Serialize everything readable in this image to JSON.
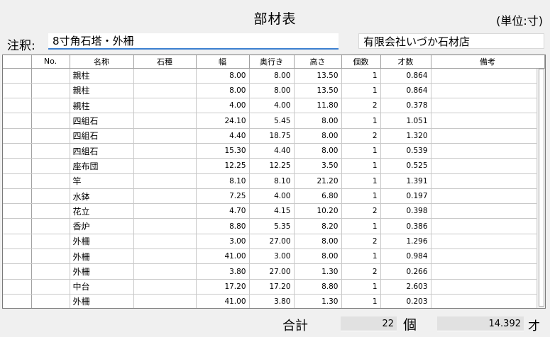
{
  "window": {
    "title": "部材表",
    "unit": "(単位:寸)"
  },
  "note": {
    "label": "注釈:",
    "value": "8寸角石塔・外柵"
  },
  "company": {
    "value": "有限会社いづか石材店"
  },
  "grid": {
    "columns": [
      "No.",
      "名称",
      "石種",
      "幅",
      "奥行き",
      "高さ",
      "個数",
      "才数",
      "備考"
    ],
    "rows": [
      {
        "no": "",
        "name": "親柱",
        "stone": "",
        "width": "8.00",
        "depth": "8.00",
        "height": "13.50",
        "count": "1",
        "size": "0.864",
        "remarks": ""
      },
      {
        "no": "",
        "name": "親柱",
        "stone": "",
        "width": "8.00",
        "depth": "8.00",
        "height": "13.50",
        "count": "1",
        "size": "0.864",
        "remarks": ""
      },
      {
        "no": "",
        "name": "親柱",
        "stone": "",
        "width": "4.00",
        "depth": "4.00",
        "height": "11.80",
        "count": "2",
        "size": "0.378",
        "remarks": ""
      },
      {
        "no": "",
        "name": "四組石",
        "stone": "",
        "width": "24.10",
        "depth": "5.45",
        "height": "8.00",
        "count": "1",
        "size": "1.051",
        "remarks": ""
      },
      {
        "no": "",
        "name": "四組石",
        "stone": "",
        "width": "4.40",
        "depth": "18.75",
        "height": "8.00",
        "count": "2",
        "size": "1.320",
        "remarks": ""
      },
      {
        "no": "",
        "name": "四組石",
        "stone": "",
        "width": "15.30",
        "depth": "4.40",
        "height": "8.00",
        "count": "1",
        "size": "0.539",
        "remarks": ""
      },
      {
        "no": "",
        "name": "座布団",
        "stone": "",
        "width": "12.25",
        "depth": "12.25",
        "height": "3.50",
        "count": "1",
        "size": "0.525",
        "remarks": ""
      },
      {
        "no": "",
        "name": "竿",
        "stone": "",
        "width": "8.10",
        "depth": "8.10",
        "height": "21.20",
        "count": "1",
        "size": "1.391",
        "remarks": ""
      },
      {
        "no": "",
        "name": "水鉢",
        "stone": "",
        "width": "7.25",
        "depth": "4.00",
        "height": "6.80",
        "count": "1",
        "size": "0.197",
        "remarks": ""
      },
      {
        "no": "",
        "name": "花立",
        "stone": "",
        "width": "4.70",
        "depth": "4.15",
        "height": "10.20",
        "count": "2",
        "size": "0.398",
        "remarks": ""
      },
      {
        "no": "",
        "name": "香炉",
        "stone": "",
        "width": "8.80",
        "depth": "5.35",
        "height": "8.20",
        "count": "1",
        "size": "0.386",
        "remarks": ""
      },
      {
        "no": "",
        "name": "外柵",
        "stone": "",
        "width": "3.00",
        "depth": "27.00",
        "height": "8.00",
        "count": "2",
        "size": "1.296",
        "remarks": ""
      },
      {
        "no": "",
        "name": "外柵",
        "stone": "",
        "width": "41.00",
        "depth": "3.00",
        "height": "8.00",
        "count": "1",
        "size": "0.984",
        "remarks": ""
      },
      {
        "no": "",
        "name": "外柵",
        "stone": "",
        "width": "3.80",
        "depth": "27.00",
        "height": "1.30",
        "count": "2",
        "size": "0.266",
        "remarks": ""
      },
      {
        "no": "",
        "name": "中台",
        "stone": "",
        "width": "17.20",
        "depth": "17.20",
        "height": "8.80",
        "count": "1",
        "size": "2.603",
        "remarks": ""
      },
      {
        "no": "",
        "name": "外柵",
        "stone": "",
        "width": "41.00",
        "depth": "3.80",
        "height": "1.30",
        "count": "1",
        "size": "0.203",
        "remarks": ""
      }
    ]
  },
  "totals": {
    "label": "合計",
    "count": "22",
    "count_unit": "個",
    "size": "14.392",
    "size_unit": "才"
  },
  "colors": {
    "window_bg": "#f0f0f0",
    "focus_underline": "#3b7fd0",
    "selected_row_underline": "#1f5fae"
  }
}
